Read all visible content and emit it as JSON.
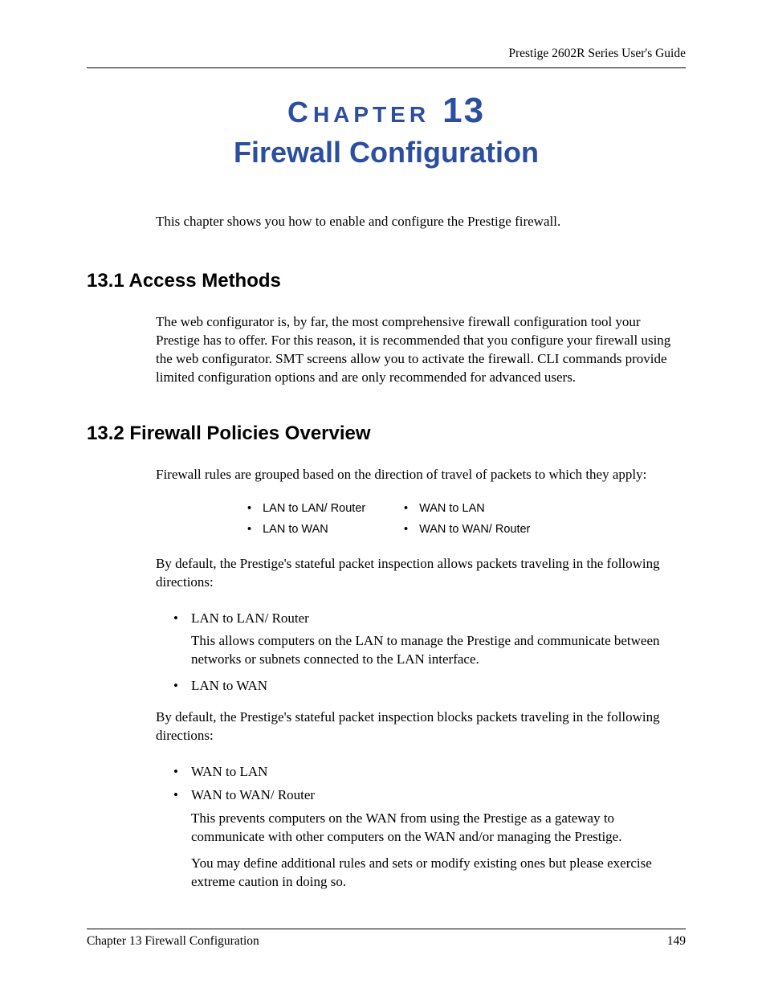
{
  "header": {
    "guide_title": "Prestige 2602R Series User's Guide"
  },
  "chapter": {
    "label_small_c": "C",
    "label_rest": "HAPTER",
    "number": "13",
    "title": "Firewall Configuration"
  },
  "intro": "This chapter shows you how to enable and configure the Prestige firewall.",
  "sections": {
    "s1": {
      "heading": "13.1  Access Methods",
      "para1": "The web configurator is, by far, the most comprehensive firewall configuration tool your Prestige has to offer. For this reason, it is recommended that you configure your firewall using the web configurator. SMT screens allow you to activate the firewall. CLI commands provide limited configuration options and are only recommended for advanced users."
    },
    "s2": {
      "heading": "13.2  Firewall Policies Overview",
      "para1": "Firewall rules are grouped based on the direction of travel of packets to which they apply:",
      "table": {
        "r1c1": "LAN to LAN/ Router",
        "r1c2": "WAN to LAN",
        "r2c1": "LAN to WAN",
        "r2c2": "WAN to WAN/ Router"
      },
      "para2": "By default, the Prestige's stateful packet inspection allows packets traveling in the following directions:",
      "allow_list": {
        "item1": "LAN to LAN/ Router",
        "item1_desc": "This allows computers on the LAN to manage the Prestige and communicate between networks or subnets connected to the LAN interface.",
        "item2": "LAN to WAN"
      },
      "para3": "By default, the Prestige's stateful packet inspection blocks packets traveling in the following directions:",
      "block_list": {
        "item1": "WAN to LAN",
        "item2": "WAN to WAN/ Router",
        "item2_desc1": "This prevents computers on the WAN from using the Prestige as a gateway to communicate with other computers on the WAN and/or managing the Prestige.",
        "item2_desc2": "You may define additional rules and sets or modify existing ones but please exercise extreme caution in doing so."
      }
    }
  },
  "footer": {
    "chapter_label": "Chapter 13 Firewall Configuration",
    "page_number": "149"
  }
}
